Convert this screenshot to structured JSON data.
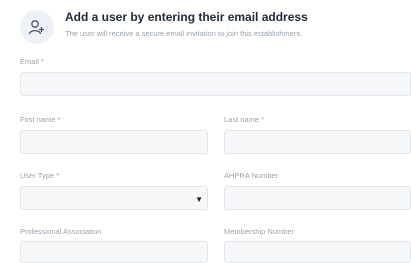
{
  "header": {
    "icon": "add-user-icon",
    "title": "Add a user by entering their email address",
    "subtitle": "The user will receive a secure email invitation to join this establishment."
  },
  "form": {
    "email": {
      "label": "Email *",
      "value": ""
    },
    "first_name": {
      "label": "First name *",
      "value": ""
    },
    "last_name": {
      "label": "Last name *",
      "value": ""
    },
    "user_type": {
      "label": "User Type *",
      "value": ""
    },
    "ahpra_number": {
      "label": "AHPRA Number",
      "value": ""
    },
    "professional_association": {
      "label": "Professional Association",
      "value": ""
    },
    "membership_number": {
      "label": "Membership Number",
      "value": ""
    }
  },
  "colors": {
    "icon_bg": "#eef2f6",
    "field_bg": "#f6f7f8",
    "field_border": "#e3e6ea",
    "label_text": "#9aa3ad"
  }
}
